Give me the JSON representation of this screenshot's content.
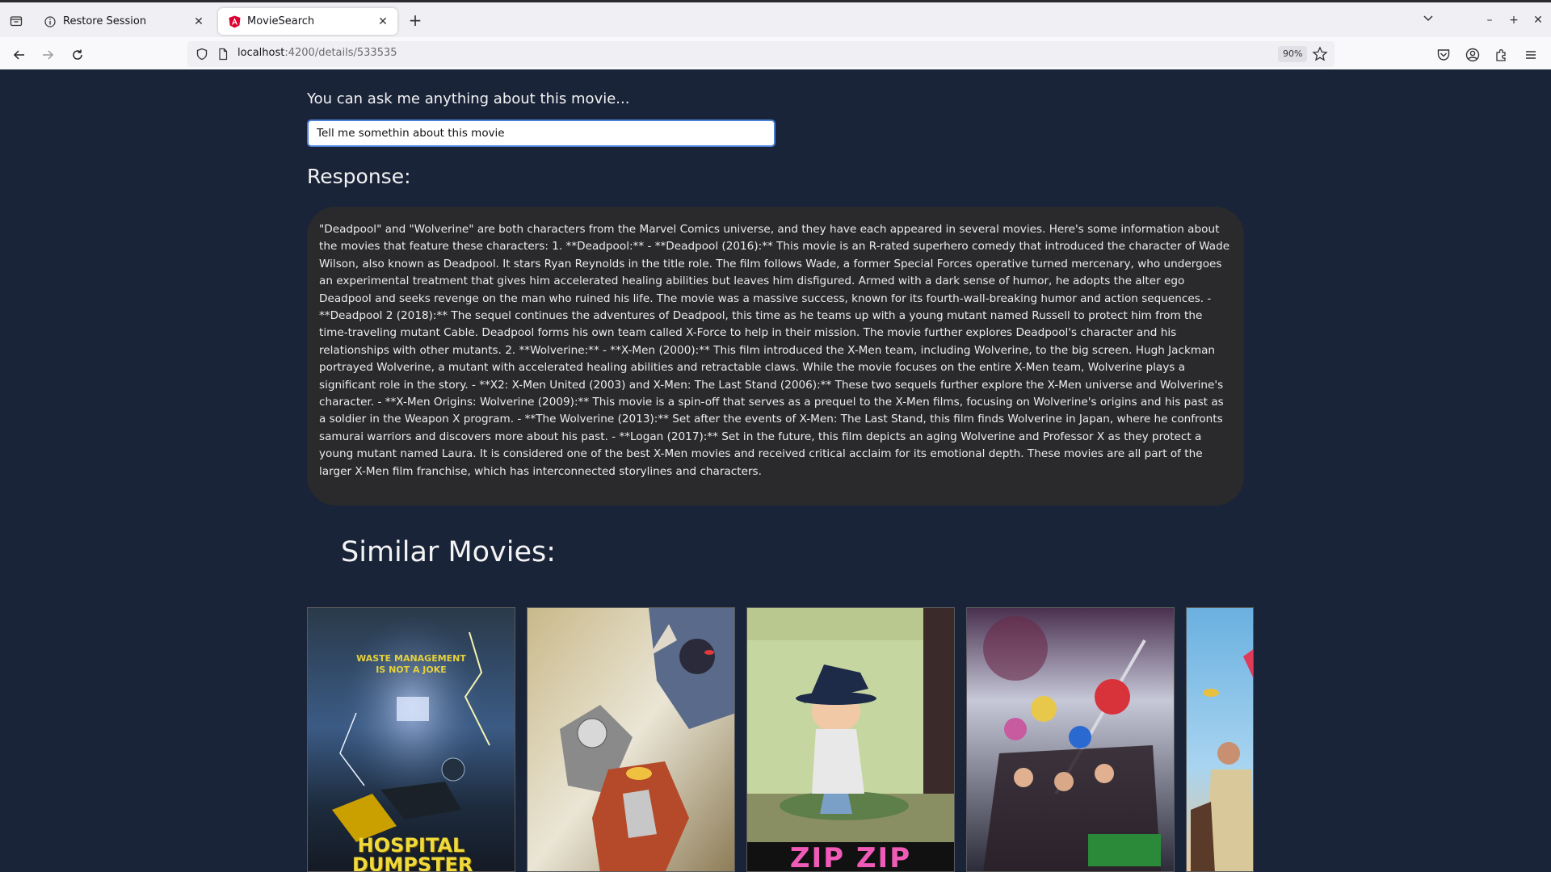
{
  "browser": {
    "tabs": [
      {
        "title": "Restore Session",
        "active": false,
        "icon": "info-icon"
      },
      {
        "title": "MovieSearch",
        "active": true,
        "icon": "angular-icon"
      }
    ],
    "url_host": "localhost",
    "url_path": ":4200/details/533535",
    "zoom": "90%"
  },
  "page": {
    "ask_label": "You can ask me anything about this movie...",
    "ask_input_value": "Tell me somethin about this movie",
    "response_title": "Response:",
    "response_text": "\"Deadpool\" and \"Wolverine\" are both characters from the Marvel Comics universe, and they have each appeared in several movies. Here's some information about the movies that feature these characters: 1. **Deadpool:** - **Deadpool (2016):** This movie is an R-rated superhero comedy that introduced the character of Wade Wilson, also known as Deadpool. It stars Ryan Reynolds in the title role. The film follows Wade, a former Special Forces operative turned mercenary, who undergoes an experimental treatment that gives him accelerated healing abilities but leaves him disfigured. Armed with a dark sense of humor, he adopts the alter ego Deadpool and seeks revenge on the man who ruined his life. The movie was a massive success, known for its fourth-wall-breaking humor and action sequences. - **Deadpool 2 (2018):** The sequel continues the adventures of Deadpool, this time as he teams up with a young mutant named Russell to protect him from the time-traveling mutant Cable. Deadpool forms his own team called X-Force to help in their mission. The movie further explores Deadpool's character and his relationships with other mutants. 2. **Wolverine:** - **X-Men (2000):** This film introduced the X-Men team, including Wolverine, to the big screen. Hugh Jackman portrayed Wolverine, a mutant with accelerated healing abilities and retractable claws. While the movie focuses on the entire X-Men team, Wolverine plays a significant role in the story. - **X2: X-Men United (2003) and X-Men: The Last Stand (2006):** These two sequels further explore the X-Men universe and Wolverine's character. - **X-Men Origins: Wolverine (2009):** This movie is a spin-off that serves as a prequel to the X-Men films, focusing on Wolverine's origins and his past as a soldier in the Weapon X program. - **The Wolverine (2013):** Set after the events of X-Men: The Last Stand, this film finds Wolverine in Japan, where he confronts samurai warriors and discovers more about his past. - **Logan (2017):** Set in the future, this film depicts an aging Wolverine and Professor X as they protect a young mutant named Laura. It is considered one of the best X-Men movies and received critical acclaim for its emotional depth. These movies are all part of the larger X-Men film franchise, which has interconnected storylines and characters.",
    "similar_title": "Similar Movies:"
  },
  "posters": [
    {
      "title": "HOSPITAL DUMPSTER",
      "tagline": "WASTE MANAGEMENT IS NOT A JOKE"
    },
    {
      "title": ""
    },
    {
      "title": "ZIP ZIP"
    },
    {
      "title": ""
    },
    {
      "title": ""
    }
  ],
  "colors": {
    "page_bg": "#1a2439",
    "response_bg": "#2a2a2d",
    "input_focus": "#4a7fd6",
    "chrome_bg": "#f0f0f4"
  }
}
